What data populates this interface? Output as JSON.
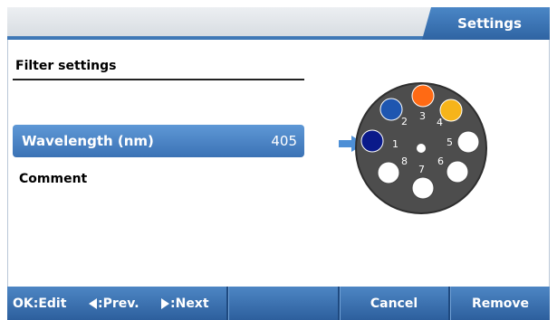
{
  "header": {
    "tab_label": "Settings"
  },
  "panel": {
    "title": "Filter settings",
    "items": [
      {
        "label": "Wavelength (nm)",
        "value": "405"
      },
      {
        "label": "Comment"
      }
    ]
  },
  "filter_wheel": {
    "positions": [
      "1",
      "2",
      "3",
      "4",
      "5",
      "6",
      "7",
      "8"
    ],
    "colors": {
      "wheel": "#4d4d4d",
      "pos1": "#0a1a8a",
      "pos2": "#1e56b0",
      "pos3": "#ff6a14",
      "pos4": "#f6b41a",
      "empty": "#ffffff"
    },
    "pointer_icon": "right-arrow-icon"
  },
  "footer": {
    "ok_hint": "OK:Edit",
    "prev_hint": ":Prev.",
    "next_hint": ":Next",
    "cancel_label": "Cancel",
    "remove_label": "Remove"
  }
}
